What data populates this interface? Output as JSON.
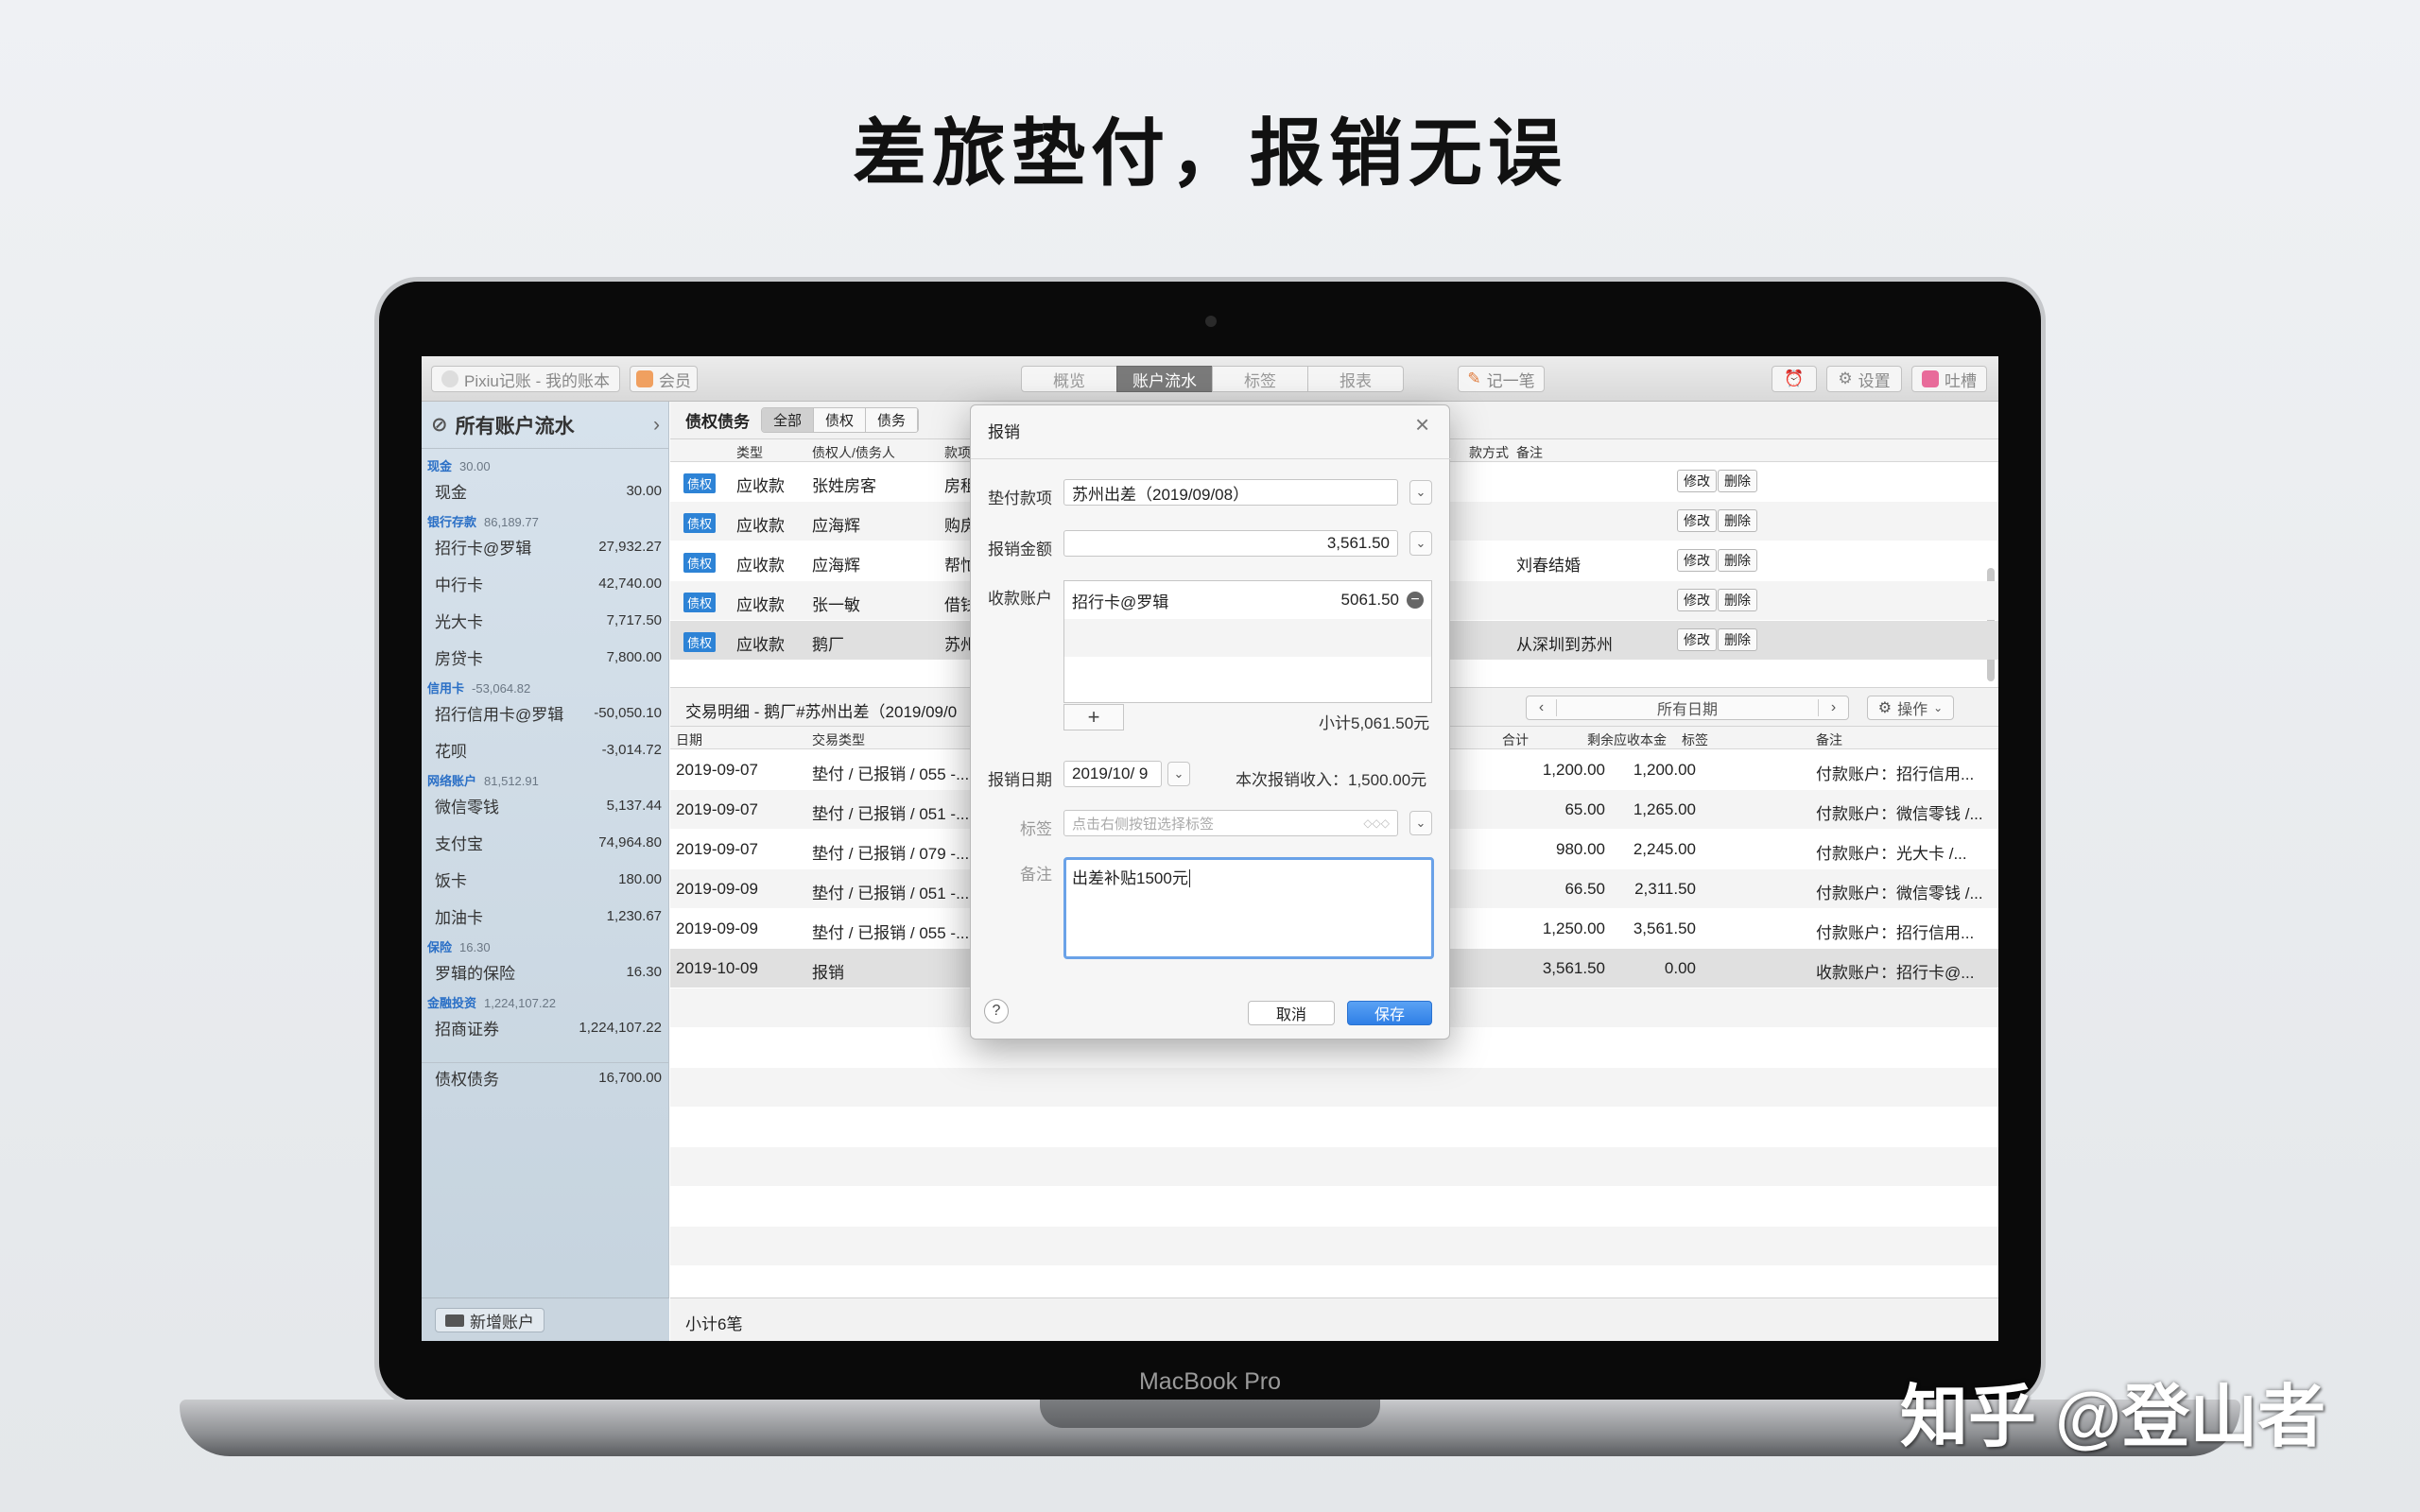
{
  "headline": "差旅垫付，报销无误",
  "device_label": "MacBook Pro",
  "watermark": "知乎 @登山者",
  "toolbar": {
    "app_title": "Pixiu记账 - 我的账本",
    "member": "会员",
    "tabs": [
      "概览",
      "账户流水",
      "标签",
      "报表"
    ],
    "active_tab": "账户流水",
    "record": "记一笔",
    "settings": "设置",
    "feedback": "吐槽"
  },
  "sidebar": {
    "header": "所有账户流水",
    "groups": [
      {
        "name": "现金",
        "amount": "30.00",
        "items": [
          {
            "name": "现金",
            "value": "30.00"
          }
        ]
      },
      {
        "name": "银行存款",
        "amount": "86,189.77",
        "items": [
          {
            "name": "招行卡@罗辑",
            "value": "27,932.27"
          },
          {
            "name": "中行卡",
            "value": "42,740.00"
          },
          {
            "name": "光大卡",
            "value": "7,717.50"
          },
          {
            "name": "房贷卡",
            "value": "7,800.00"
          }
        ]
      },
      {
        "name": "信用卡",
        "amount": "-53,064.82",
        "items": [
          {
            "name": "招行信用卡@罗辑",
            "value": "-50,050.10"
          },
          {
            "name": "花呗",
            "value": "-3,014.72"
          }
        ]
      },
      {
        "name": "网络账户",
        "amount": "81,512.91",
        "items": [
          {
            "name": "微信零钱",
            "value": "5,137.44"
          },
          {
            "name": "支付宝",
            "value": "74,964.80"
          },
          {
            "name": "饭卡",
            "value": "180.00"
          },
          {
            "name": "加油卡",
            "value": "1,230.67"
          }
        ]
      },
      {
        "name": "保险",
        "amount": "16.30",
        "items": [
          {
            "name": "罗辑的保险",
            "value": "16.30"
          }
        ]
      },
      {
        "name": "金融投资",
        "amount": "1,224,107.22",
        "items": [
          {
            "name": "招商证券",
            "value": "1,224,107.22"
          }
        ]
      }
    ],
    "debt": {
      "name": "债权债务",
      "value": "16,700.00"
    },
    "add_account": "新增账户"
  },
  "debt_panel": {
    "title": "债权债务",
    "filters": [
      "全部",
      "债权",
      "债务"
    ],
    "columns": [
      "类型",
      "债权人/债务人",
      "款项",
      "款方式",
      "备注"
    ],
    "rows": [
      {
        "badge": "债权",
        "type": "应收款",
        "party": "张姓房客",
        "item": "房租",
        "note": ""
      },
      {
        "badge": "债权",
        "type": "应收款",
        "party": "应海辉",
        "item": "购房",
        "note": ""
      },
      {
        "badge": "债权",
        "type": "应收款",
        "party": "应海辉",
        "item": "帮忙",
        "note": "刘春结婚"
      },
      {
        "badge": "债权",
        "type": "应收款",
        "party": "张一敏",
        "item": "借钱",
        "note": ""
      },
      {
        "badge": "债权",
        "type": "应收款",
        "party": "鹅厂",
        "item": "苏州",
        "note": "从深圳到苏州"
      }
    ],
    "edit": "修改",
    "delete": "删除"
  },
  "detail": {
    "title": "交易明细 - 鹅厂#苏州出差（2019/09/0",
    "date_range": "所有日期",
    "action": "操作",
    "columns": [
      "日期",
      "交易类型",
      "合计",
      "剩余应收本金",
      "标签",
      "备注"
    ],
    "rows": [
      {
        "date": "2019-09-07",
        "type": "垫付 / 已报销 / 055 -...",
        "total": "1,200.00",
        "remain": "1,200.00",
        "note": "付款账户：招行信用..."
      },
      {
        "date": "2019-09-07",
        "type": "垫付 / 已报销 / 051 -...",
        "total": "65.00",
        "remain": "1,265.00",
        "note": "付款账户：微信零钱 /..."
      },
      {
        "date": "2019-09-07",
        "type": "垫付 / 已报销 / 079 -...",
        "total": "980.00",
        "remain": "2,245.00",
        "note": "付款账户：光大卡 /..."
      },
      {
        "date": "2019-09-09",
        "type": "垫付 / 已报销 / 051 -...",
        "total": "66.50",
        "remain": "2,311.50",
        "note": "付款账户：微信零钱 /..."
      },
      {
        "date": "2019-09-09",
        "type": "垫付 / 已报销 / 055 -...",
        "total": "1,250.00",
        "remain": "3,561.50",
        "note": "付款账户：招行信用..."
      },
      {
        "date": "2019-10-09",
        "type": "报销",
        "total": "3,561.50",
        "remain": "0.00",
        "note": "收款账户：招行卡@..."
      }
    ],
    "footer": "小计6笔"
  },
  "dialog": {
    "title": "报销",
    "advance_label": "垫付款项",
    "advance_value": "苏州出差（2019/09/08）",
    "amount_label": "报销金额",
    "amount_value": "3,561.50",
    "account_label": "收款账户",
    "account_name": "招行卡@罗辑",
    "account_amount": "5061.50",
    "subtotal": "小计5,061.50元",
    "date_label": "报销日期",
    "date_value": "2019/10/ 9",
    "income_text": "本次报销收入：1,500.00元",
    "tag_label": "标签",
    "tag_placeholder": "点击右侧按钮选择标签",
    "memo_label": "备注",
    "memo_value": "出差补贴1500元",
    "cancel": "取消",
    "save": "保存",
    "help": "?"
  }
}
